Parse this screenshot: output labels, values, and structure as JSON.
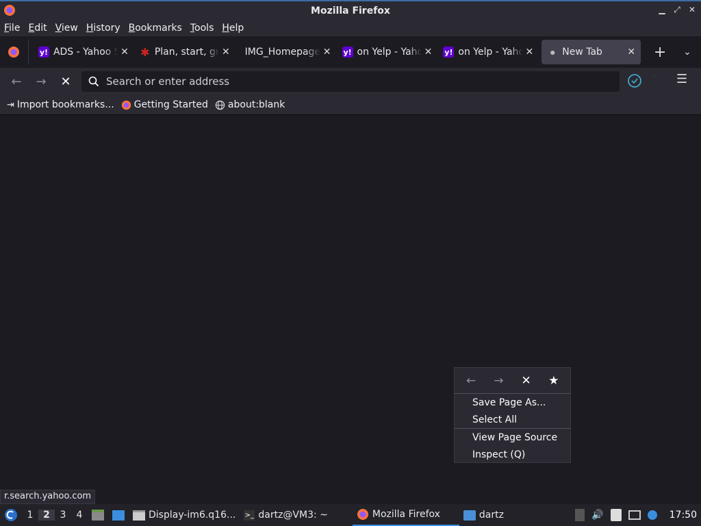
{
  "window": {
    "title": "Mozilla Firefox"
  },
  "menu": [
    {
      "label": "File",
      "u": "F",
      "rest": "ile"
    },
    {
      "label": "Edit",
      "u": "E",
      "rest": "dit"
    },
    {
      "label": "View",
      "u": "V",
      "rest": "iew"
    },
    {
      "label": "History",
      "u": "H",
      "rest": "istory"
    },
    {
      "label": "Bookmarks",
      "u": "B",
      "rest": "ookmarks"
    },
    {
      "label": "Tools",
      "u": "T",
      "rest": "ools"
    },
    {
      "label": "Help",
      "u": "H",
      "rest": "elp"
    }
  ],
  "tabs": [
    {
      "label": "ADS - Yahoo Search",
      "fav": "yahoo"
    },
    {
      "label": "Plan, start, grow",
      "fav": "yelp"
    },
    {
      "label": "IMG_HomepageHero",
      "fav": "none"
    },
    {
      "label": "on Yelp - Yahoo",
      "fav": "yahoo"
    },
    {
      "label": "on Yelp - Yahoo",
      "fav": "yahoo"
    },
    {
      "label": "New Tab",
      "fav": "dot"
    }
  ],
  "urlbar": {
    "placeholder": "Search or enter address"
  },
  "bookmarks": [
    {
      "label": "Import bookmarks...",
      "icon": "import-icon"
    },
    {
      "label": "Getting Started",
      "icon": "firefox-icon"
    },
    {
      "label": "about:blank",
      "icon": "globe-icon"
    }
  ],
  "context_menu": {
    "items": [
      "Save Page As...",
      "Select All",
      "View Page Source",
      "Inspect (Q)"
    ]
  },
  "status": "r.search.yahoo.com",
  "taskbar": {
    "workspaces": [
      "1",
      "2",
      "3",
      "4"
    ],
    "current_workspace": "2",
    "windows": [
      "Display-im6.q16...",
      "dartz@VM3: ~",
      "Mozilla Firefox",
      "dartz"
    ],
    "clock": "17:50"
  },
  "colors": {
    "accent": "#3b8ede",
    "chrome": "#2b2a33",
    "content": "#1c1b22"
  }
}
